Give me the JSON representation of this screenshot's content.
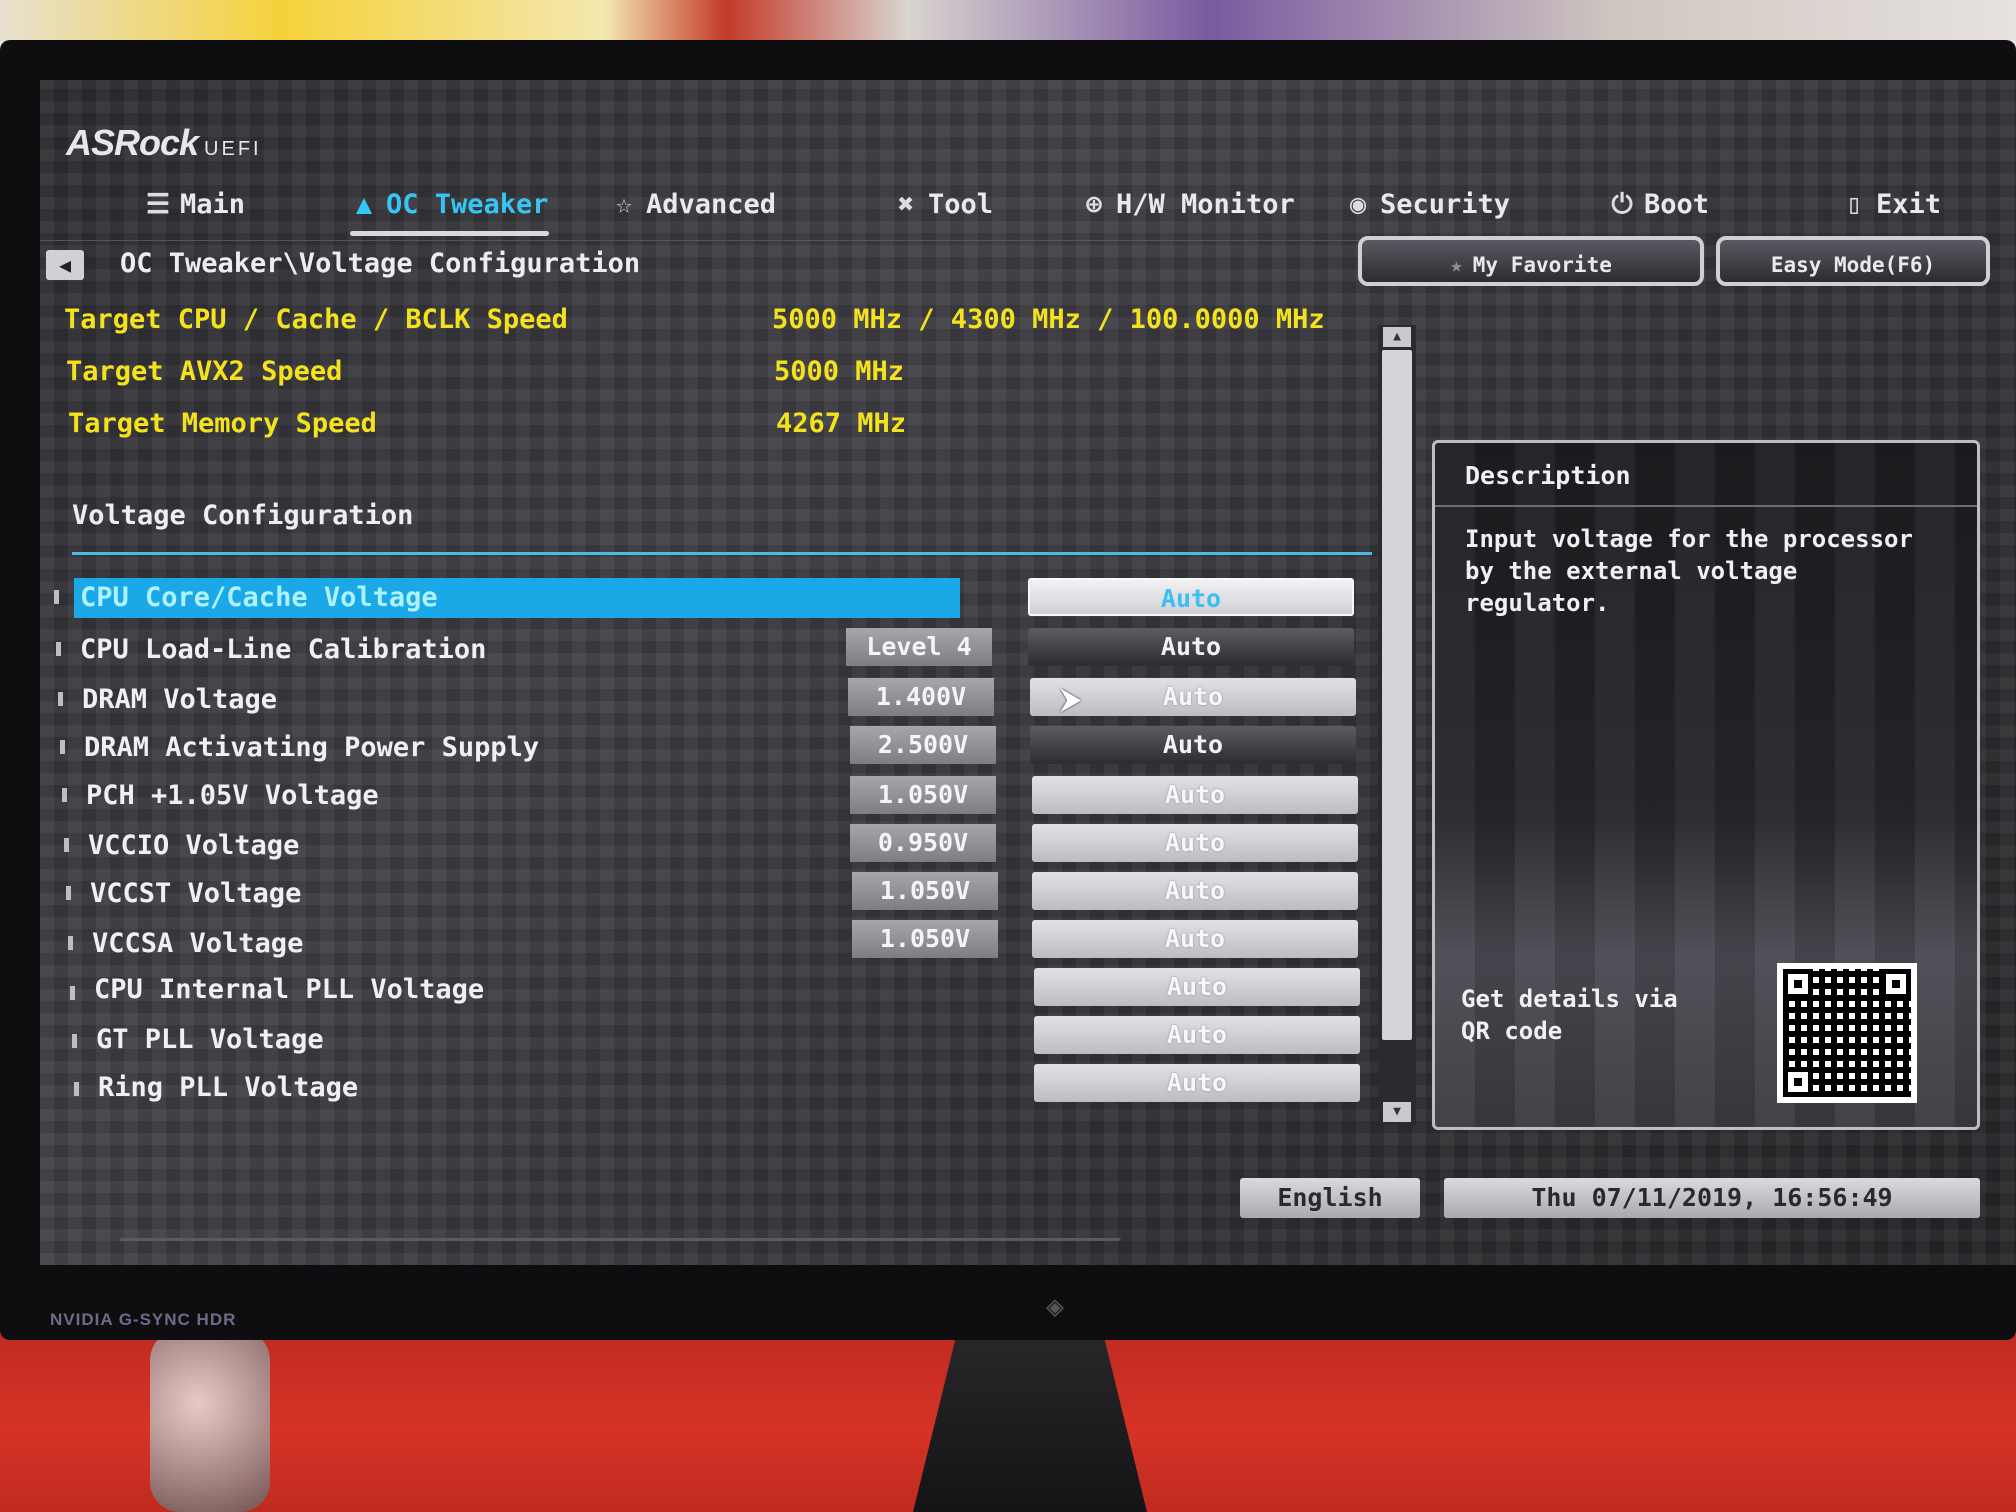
{
  "brand": {
    "name": "ASRock",
    "suffix": "UEFI"
  },
  "nav": {
    "tabs": [
      {
        "label": "Main",
        "icon": "list-icon"
      },
      {
        "label": "OC Tweaker",
        "icon": "flame-icon",
        "active": true
      },
      {
        "label": "Advanced",
        "icon": "star-icon"
      },
      {
        "label": "Tool",
        "icon": "tools-icon"
      },
      {
        "label": "H/W Monitor",
        "icon": "monitor-gauge-icon"
      },
      {
        "label": "Security",
        "icon": "shield-icon"
      },
      {
        "label": "Boot",
        "icon": "power-icon"
      },
      {
        "label": "Exit",
        "icon": "exit-door-icon"
      }
    ]
  },
  "breadcrumb": "OC Tweaker\\Voltage Configuration",
  "buttons": {
    "favorite": "My Favorite",
    "easy_mode": "Easy Mode(F6)"
  },
  "targets": [
    {
      "label": "Target CPU / Cache / BCLK Speed",
      "value": "5000 MHz / 4300 MHz / 100.0000 MHz"
    },
    {
      "label": "Target AVX2 Speed",
      "value": "5000 MHz"
    },
    {
      "label": "Target Memory Speed",
      "value": "4267 MHz"
    }
  ],
  "section_title": "Voltage Configuration",
  "rows": [
    {
      "label": "CPU Core/Cache Voltage",
      "current": "",
      "option": "Auto",
      "selected": true
    },
    {
      "label": "CPU Load-Line Calibration",
      "current": "Level 4",
      "option": "Auto"
    },
    {
      "label": "DRAM Voltage",
      "current": "1.400V",
      "option": "Auto"
    },
    {
      "label": "DRAM Activating Power Supply",
      "current": "2.500V",
      "option": "Auto"
    },
    {
      "label": "PCH +1.05V Voltage",
      "current": "1.050V",
      "option": "Auto"
    },
    {
      "label": "VCCIO Voltage",
      "current": "0.950V",
      "option": "Auto"
    },
    {
      "label": "VCCST Voltage",
      "current": "1.050V",
      "option": "Auto"
    },
    {
      "label": "VCCSA Voltage",
      "current": "1.050V",
      "option": "Auto"
    },
    {
      "label": "CPU Internal PLL Voltage",
      "current": "",
      "option": "Auto"
    },
    {
      "label": "GT PLL Voltage",
      "current": "",
      "option": "Auto"
    },
    {
      "label": "Ring PLL Voltage",
      "current": "",
      "option": "Auto"
    }
  ],
  "description": {
    "title": "Description",
    "text": "Input voltage for the processor by the external voltage regulator.",
    "qr_text": "Get details via QR code"
  },
  "footer": {
    "language": "English",
    "datetime": "Thu 07/11/2019, 16:56:49"
  },
  "monitor": {
    "brand_text": "NVIDIA G-SYNC HDR"
  },
  "colors": {
    "accent": "#35c6f4",
    "target_text": "#f4e21c",
    "selected_row": "#1aa8e6"
  }
}
